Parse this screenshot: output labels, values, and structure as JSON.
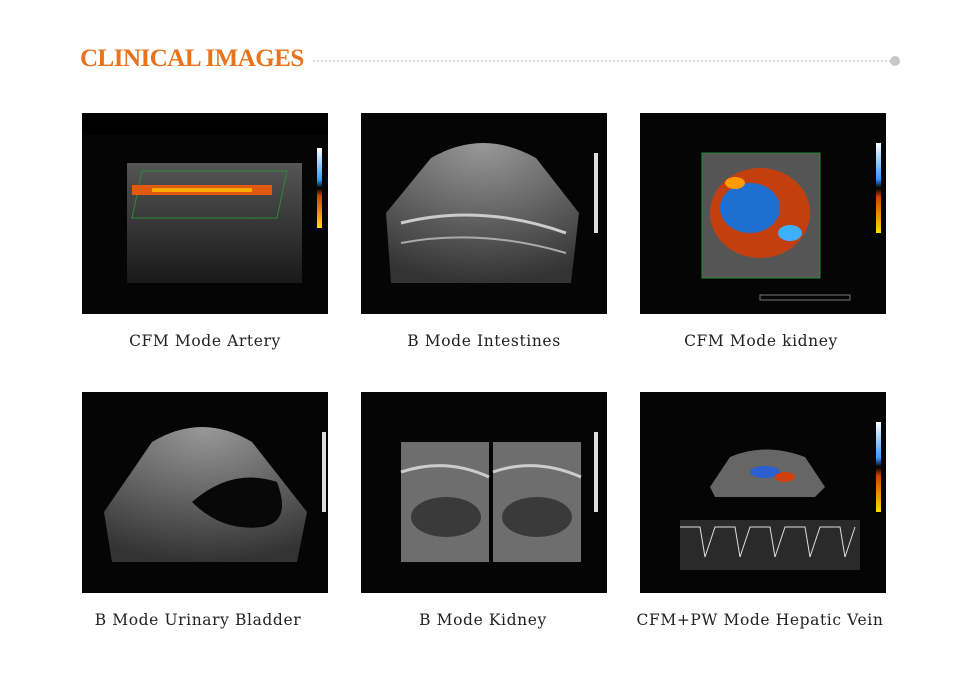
{
  "section_title": "CLINICAL IMAGES",
  "images": [
    {
      "caption": "CFM Mode Artery"
    },
    {
      "caption": "B Mode Intestines"
    },
    {
      "caption": "CFM Mode kidney"
    },
    {
      "caption": "B Mode Urinary Bladder"
    },
    {
      "caption": "B Mode Kidney"
    },
    {
      "caption": "CFM+PW Mode Hepatic Vein"
    }
  ]
}
